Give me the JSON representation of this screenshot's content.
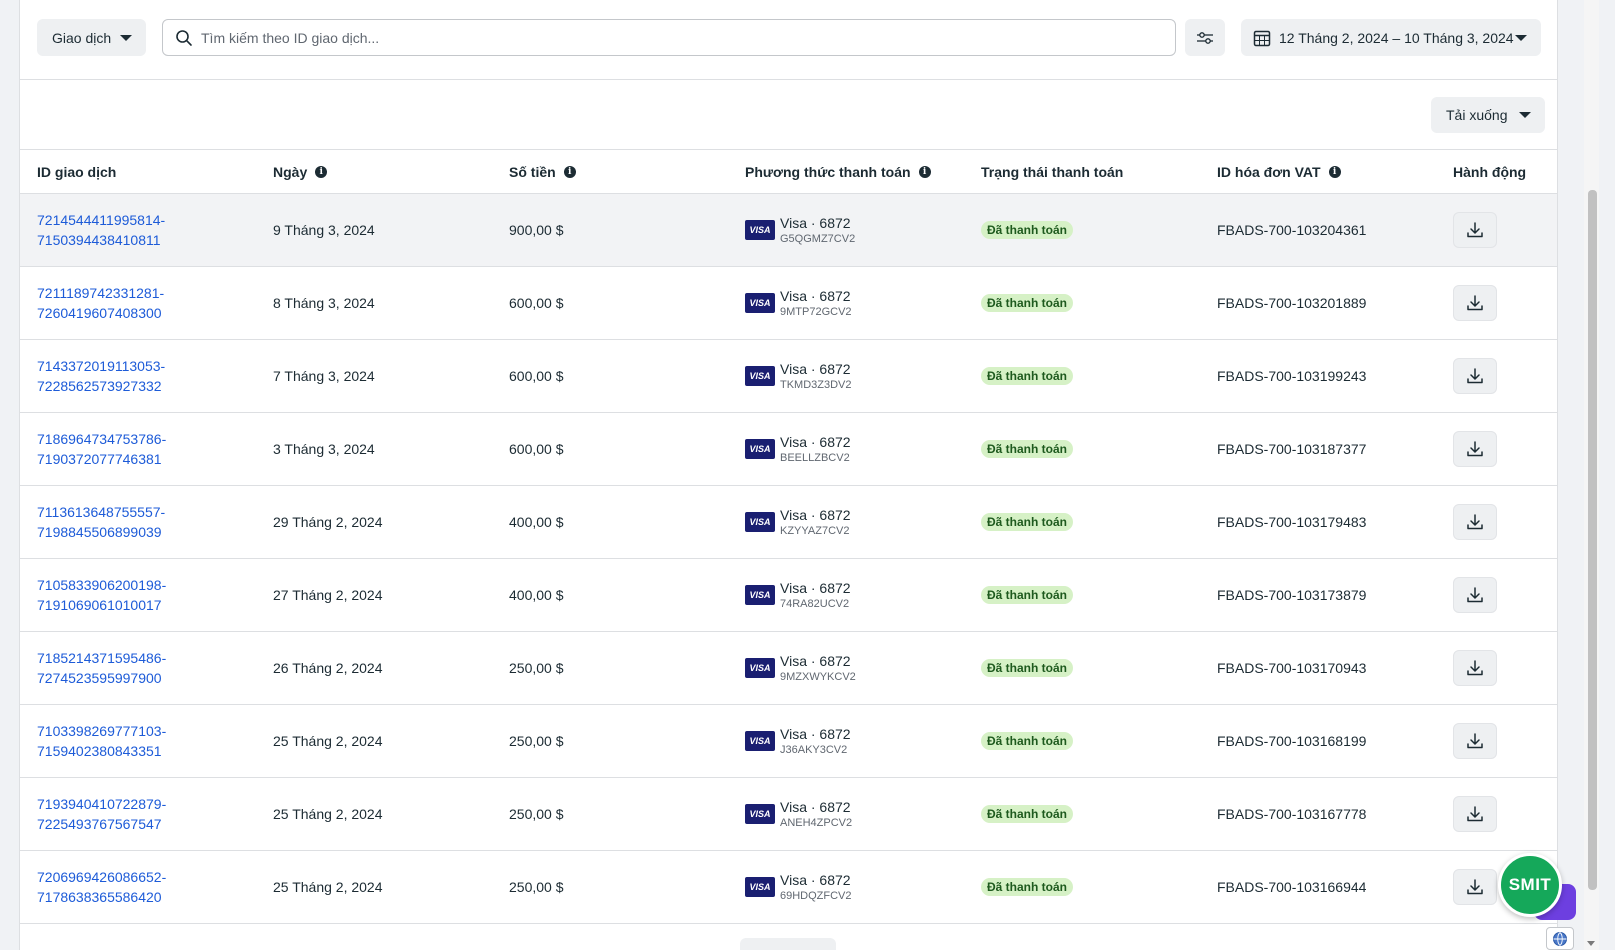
{
  "toolbar": {
    "type_select": "Giao dịch",
    "search_placeholder": "Tìm kiếm theo ID giao dịch...",
    "date_range": "12 Tháng 2, 2024 – 10 Tháng 3, 2024",
    "download_label": "Tải xuống"
  },
  "table": {
    "columns": [
      "ID giao dịch",
      "Ngày",
      "Số tiền",
      "Phương thức thanh toán",
      "Trạng thái thanh toán",
      "ID hóa đơn VAT",
      "Hành động"
    ],
    "rows": [
      {
        "id1": "7214544411995814-",
        "id2": "7150394438410811",
        "date": "9 Tháng 3, 2024",
        "amount": "900,00 $",
        "method": "Visa · 6872",
        "code": "G5QGMZ7CV2",
        "status": "Đã thanh toán",
        "vat": "FBADS-700-103204361"
      },
      {
        "id1": "7211189742331281-",
        "id2": "7260419607408300",
        "date": "8 Tháng 3, 2024",
        "amount": "600,00 $",
        "method": "Visa · 6872",
        "code": "9MTP72GCV2",
        "status": "Đã thanh toán",
        "vat": "FBADS-700-103201889"
      },
      {
        "id1": "7143372019113053-",
        "id2": "7228562573927332",
        "date": "7 Tháng 3, 2024",
        "amount": "600,00 $",
        "method": "Visa · 6872",
        "code": "TKMD3Z3DV2",
        "status": "Đã thanh toán",
        "vat": "FBADS-700-103199243"
      },
      {
        "id1": "7186964734753786-",
        "id2": "7190372077746381",
        "date": "3 Tháng 3, 2024",
        "amount": "600,00 $",
        "method": "Visa · 6872",
        "code": "BEELLZBCV2",
        "status": "Đã thanh toán",
        "vat": "FBADS-700-103187377"
      },
      {
        "id1": "7113613648755557-",
        "id2": "7198845506899039",
        "date": "29 Tháng 2, 2024",
        "amount": "400,00 $",
        "method": "Visa · 6872",
        "code": "KZYYAZ7CV2",
        "status": "Đã thanh toán",
        "vat": "FBADS-700-103179483"
      },
      {
        "id1": "7105833906200198-",
        "id2": "7191069061010017",
        "date": "27 Tháng 2, 2024",
        "amount": "400,00 $",
        "method": "Visa · 6872",
        "code": "74RA82UCV2",
        "status": "Đã thanh toán",
        "vat": "FBADS-700-103173879"
      },
      {
        "id1": "7185214371595486-",
        "id2": "7274523595997900",
        "date": "26 Tháng 2, 2024",
        "amount": "250,00 $",
        "method": "Visa · 6872",
        "code": "9MZXWYKCV2",
        "status": "Đã thanh toán",
        "vat": "FBADS-700-103170943"
      },
      {
        "id1": "7103398269777103-",
        "id2": "7159402380843351",
        "date": "25 Tháng 2, 2024",
        "amount": "250,00 $",
        "method": "Visa · 6872",
        "code": "J36AKY3CV2",
        "status": "Đã thanh toán",
        "vat": "FBADS-700-103168199"
      },
      {
        "id1": "7193940410722879-",
        "id2": "7225493767567547",
        "date": "25 Tháng 2, 2024",
        "amount": "250,00 $",
        "method": "Visa · 6872",
        "code": "ANEH4ZPCV2",
        "status": "Đã thanh toán",
        "vat": "FBADS-700-103167778"
      },
      {
        "id1": "7206969426086652-",
        "id2": "7178638365586420",
        "date": "25 Tháng 2, 2024",
        "amount": "250,00 $",
        "method": "Visa · 6872",
        "code": "69HDQZFCV2",
        "status": "Đã thanh toán",
        "vat": "FBADS-700-103166944"
      }
    ]
  },
  "card_brand": "VISA",
  "widget": {
    "label": "SMIT"
  },
  "icons": {
    "search": "search-icon",
    "filter": "sliders-icon",
    "calendar": "calendar-icon",
    "download": "download-icon",
    "info": "info-icon",
    "globe": "globe-icon"
  }
}
